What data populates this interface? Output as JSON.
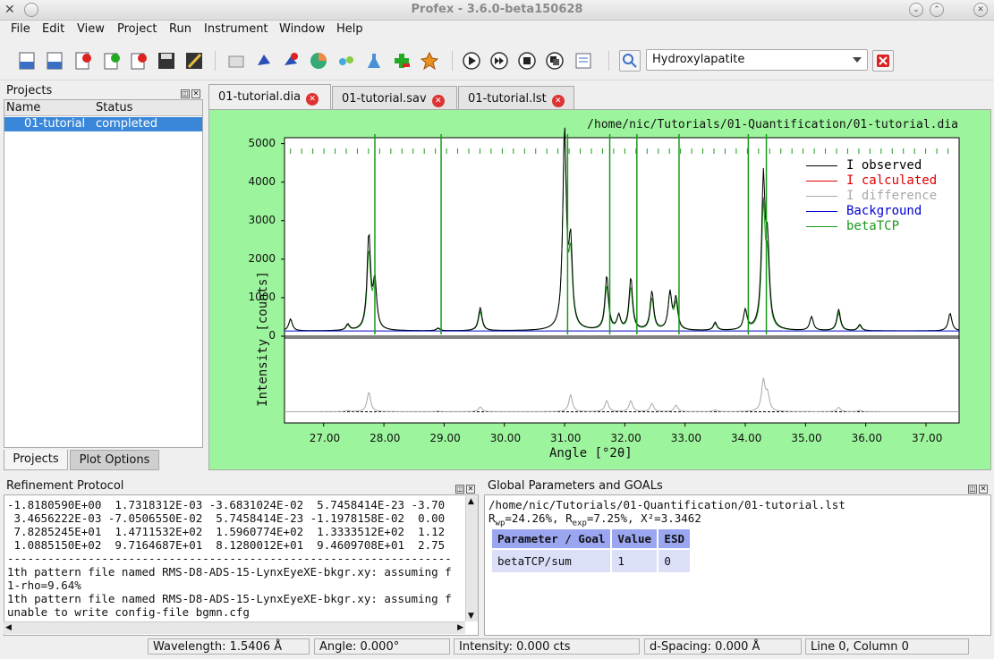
{
  "window": {
    "title": "Profex - 3.6.0-beta150628"
  },
  "menu": [
    "File",
    "Edit",
    "View",
    "Project",
    "Run",
    "Instrument",
    "Window",
    "Help"
  ],
  "toolbar": {
    "phase_combo": "Hydroxylapatite"
  },
  "projects_dock": {
    "title": "Projects",
    "columns": [
      "Name",
      "Status"
    ],
    "rows": [
      {
        "name": "01-tutorial",
        "status": "completed"
      }
    ],
    "bottom_tabs": [
      "Projects",
      "Plot Options"
    ]
  },
  "doc_tabs": [
    "01-tutorial.dia",
    "01-tutorial.sav",
    "01-tutorial.lst"
  ],
  "plot": {
    "path": "/home/nic/Tutorials/01-Quantification/01-tutorial.dia",
    "legend": [
      {
        "label": "I observed",
        "color": "#000000"
      },
      {
        "label": "I calculated",
        "color": "#e00000"
      },
      {
        "label": "I difference",
        "color": "#a8a8a8"
      },
      {
        "label": "Background",
        "color": "#0000d0"
      },
      {
        "label": "betaTCP",
        "color": "#1a9a1a"
      }
    ]
  },
  "chart_data": {
    "type": "line",
    "xlabel": "Angle [°2θ]",
    "ylabel": "Intensity [counts]",
    "xlim": [
      26.35,
      37.55
    ],
    "ylim": [
      0,
      5200
    ],
    "x_ticks": [
      "27.00",
      "28.00",
      "29.00",
      "30.00",
      "31.00",
      "32.00",
      "33.00",
      "34.00",
      "35.00",
      "36.00",
      "37.00"
    ],
    "y_ticks": [
      "0",
      "1000",
      "2000",
      "3000",
      "4000",
      "5000"
    ],
    "peaks_observed": [
      {
        "x": 26.45,
        "y": 400
      },
      {
        "x": 27.4,
        "y": 250
      },
      {
        "x": 27.75,
        "y": 2550
      },
      {
        "x": 27.85,
        "y": 1300
      },
      {
        "x": 28.9,
        "y": 160
      },
      {
        "x": 29.6,
        "y": 700
      },
      {
        "x": 31.0,
        "y": 5250
      },
      {
        "x": 31.1,
        "y": 2200
      },
      {
        "x": 31.7,
        "y": 1500
      },
      {
        "x": 31.9,
        "y": 450
      },
      {
        "x": 32.1,
        "y": 1450
      },
      {
        "x": 32.45,
        "y": 1100
      },
      {
        "x": 32.75,
        "y": 1050
      },
      {
        "x": 32.85,
        "y": 900
      },
      {
        "x": 33.5,
        "y": 300
      },
      {
        "x": 34.0,
        "y": 600
      },
      {
        "x": 34.3,
        "y": 3900
      },
      {
        "x": 34.37,
        "y": 2100
      },
      {
        "x": 35.1,
        "y": 450
      },
      {
        "x": 35.55,
        "y": 650
      },
      {
        "x": 35.9,
        "y": 250
      },
      {
        "x": 37.4,
        "y": 550
      }
    ],
    "betaTCP_sticks": [
      27.85,
      28.95,
      31.05,
      31.75,
      32.2,
      32.9,
      34.05,
      34.35
    ]
  },
  "refinement": {
    "title": "Refinement Protocol",
    "lines": [
      "-1.8180590E+00  1.7318312E-03 -3.6831024E-02  5.7458414E-23 -3.70",
      " 3.4656222E-03 -7.0506550E-02  5.7458414E-23 -1.1978158E-02  0.00",
      " 7.8285245E+01  1.4711532E+02  1.5960774E+02  1.3333512E+02  1.12",
      " 1.0885150E+02  9.7164687E+01  8.1280012E+01  9.4609708E+01  2.75",
      "------------------------------------------------------------------",
      "1th pattern file named RMS-D8-ADS-15-LynxEyeXE-bkgr.xy: assuming f",
      "1-rho=9.64%",
      "1th pattern file named RMS-D8-ADS-15-LynxEyeXE-bkgr.xy: assuming f",
      "unable to write config-file bgmn.cfg"
    ]
  },
  "global": {
    "title": "Global Parameters and GOALs",
    "path": "/home/nic/Tutorials/01-Quantification/01-tutorial.lst",
    "rwp": "R",
    "stats_sub_wp": "wp",
    "stats_a": "=24.26%, R",
    "stats_sub_exp": "exp",
    "stats_b": "=7.25%, X²=3.3462",
    "table_headers": [
      "Parameter / Goal",
      "Value",
      "ESD"
    ],
    "table_rows": [
      [
        "betaTCP/sum",
        "1",
        "0"
      ]
    ]
  },
  "status": {
    "wavelength": "Wavelength: 1.5406 Å",
    "angle": "Angle:    0.000°",
    "intensity": "Intensity:      0.000 cts",
    "dspacing": "d-Spacing:  0.000 Å",
    "cursor": "Line 0, Column 0"
  }
}
